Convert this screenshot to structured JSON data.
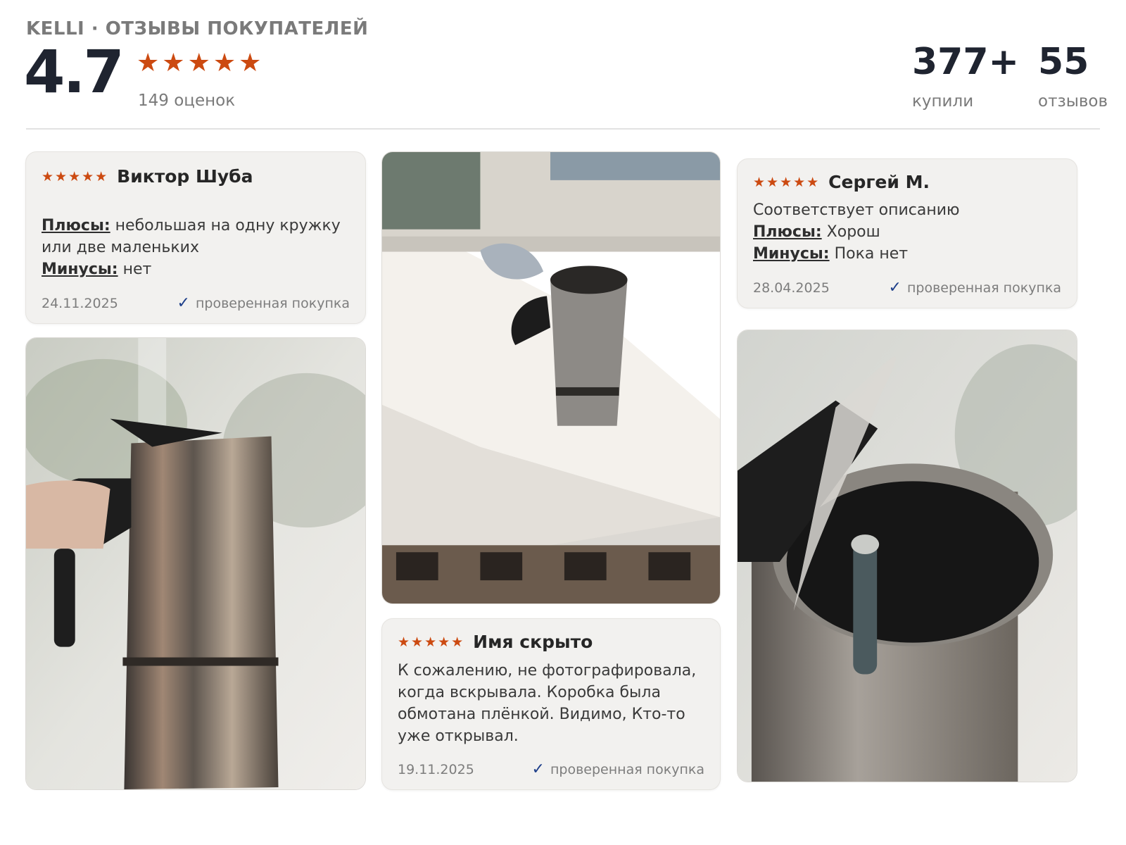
{
  "header": {
    "brand": "KELLI · ОТЗЫВЫ ПОКУПАТЕЛЕЙ",
    "rating": "4.7",
    "stars": "★★★★★",
    "ratings_count": "149 оценок",
    "bought_value": "377+",
    "bought_label": "купили",
    "reviews_value": "55",
    "reviews_label": "отзывов"
  },
  "labels": {
    "pros": "Плюсы:",
    "cons": "Минусы:",
    "verified": "проверенная покупка",
    "check": "✓"
  },
  "reviews": [
    {
      "stars": "★★★★★",
      "author": "Виктор Шуба",
      "pros": "небольшая на одну кружку или две маленьких",
      "cons": "нет",
      "date": "24.11.2025"
    },
    {
      "stars": "★★★★★",
      "author": "Имя скрыто",
      "text": "К сожалению, не фотографировала, когда вскрывала. Коробка была обмотана плёнкой. Видимо, Кто-то уже открывал.",
      "date": "19.11.2025"
    },
    {
      "stars": "★★★★★",
      "author": "Сергей М.",
      "text": "Соответствует описанию",
      "pros": "Хорош",
      "cons": "Пока нет",
      "date": "28.04.2025"
    }
  ],
  "colors": {
    "star": "#cc4a11",
    "check": "#1e3f8a",
    "card_bg": "#f2f1ef"
  }
}
